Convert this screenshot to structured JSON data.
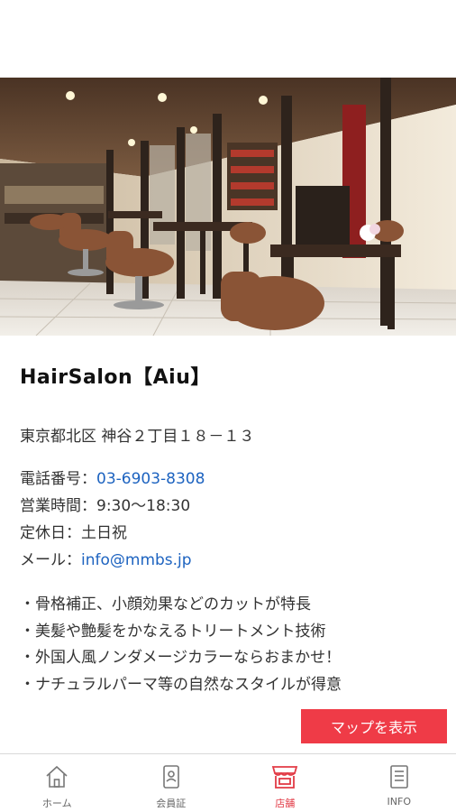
{
  "shop": {
    "name": "HairSalon【Aiu】",
    "address": "東京都北区 神谷２丁目１８－１３",
    "phone_label": "電話番号：",
    "phone": "03-6903-8308",
    "hours_label": "営業時間：",
    "hours": "9:30〜18:30",
    "closed_label": "定休日：",
    "closed": "土日祝",
    "email_label": "メール：",
    "email": "info@mmbs.jp",
    "features": [
      "・骨格補正、小顔効果などのカットが特長",
      "・美髪や艶髪をかなえるトリートメント技術",
      "・外国人風ノンダメージカラーならおまかせ！",
      "・ナチュラルパーマ等の自然なスタイルが得意"
    ]
  },
  "map_button": {
    "label": "マップを表示"
  },
  "tabbar": {
    "items": [
      {
        "label": "ホーム",
        "icon": "home-icon",
        "active": false
      },
      {
        "label": "会員証",
        "icon": "member-card-icon",
        "active": false
      },
      {
        "label": "店舗",
        "icon": "store-icon",
        "active": true
      },
      {
        "label": "INFO",
        "icon": "info-list-icon",
        "active": false
      }
    ]
  },
  "colors": {
    "accent": "#ef3b47",
    "active_tab": "#e23b46",
    "link": "#1d63c0"
  }
}
